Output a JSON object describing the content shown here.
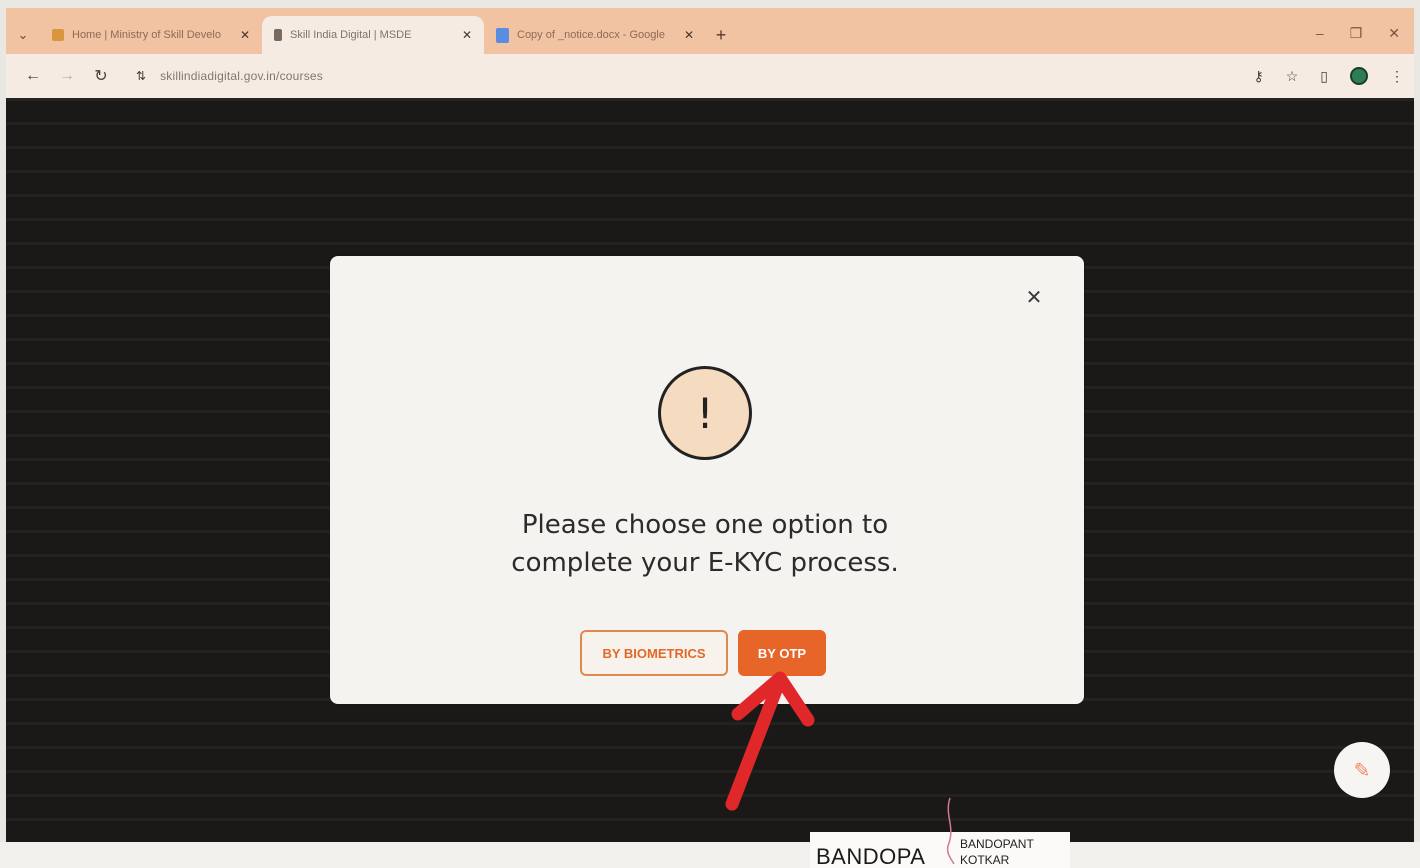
{
  "browser": {
    "tabs": [
      {
        "title": "Home | Ministry of Skill Develo",
        "favicon": "orange-favicon-icon",
        "active": false
      },
      {
        "title": "Skill India Digital | MSDE",
        "favicon": "skill-india-favicon-icon",
        "active": true
      },
      {
        "title": "Copy of _notice.docx - Google",
        "favicon": "google-docs-icon",
        "active": false
      }
    ],
    "url": "skillindiadigital.gov.in/courses",
    "accent": "#f2c3a3"
  },
  "modal": {
    "message": "Please choose one option to complete your E-KYC process.",
    "icon": "exclamation-icon",
    "buttons": {
      "biometrics": "BY BIOMETRICS",
      "otp": "BY OTP"
    },
    "accent_color": "#e8652a"
  },
  "annotation": {
    "arrow_color": "#e0282a",
    "signature": "BANDOPA",
    "stamp_line1": "BANDOPANT",
    "stamp_line2": "KOTKAR"
  }
}
